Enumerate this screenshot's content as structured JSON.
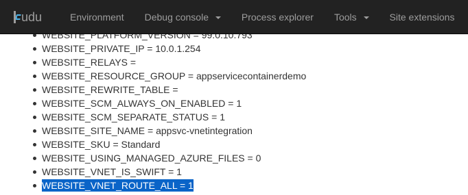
{
  "navbar": {
    "brand": "udu",
    "items": [
      {
        "label": "Environment",
        "dropdown": false
      },
      {
        "label": "Debug console",
        "dropdown": true
      },
      {
        "label": "Process explorer",
        "dropdown": false
      },
      {
        "label": "Tools",
        "dropdown": true
      },
      {
        "label": "Site extensions",
        "dropdown": false
      }
    ]
  },
  "env_vars": [
    {
      "text": "WEBSITE_PLATFORM_VERSION = 99.0.10.793",
      "selected": false
    },
    {
      "text": "WEBSITE_PRIVATE_IP = 10.0.1.254",
      "selected": false
    },
    {
      "text": "WEBSITE_RELAYS =",
      "selected": false
    },
    {
      "text": "WEBSITE_RESOURCE_GROUP = appservicecontainerdemo",
      "selected": false
    },
    {
      "text": "WEBSITE_REWRITE_TABLE =",
      "selected": false
    },
    {
      "text": "WEBSITE_SCM_ALWAYS_ON_ENABLED = 1",
      "selected": false
    },
    {
      "text": "WEBSITE_SCM_SEPARATE_STATUS = 1",
      "selected": false
    },
    {
      "text": "WEBSITE_SITE_NAME = appsvc-vnetintegration",
      "selected": false
    },
    {
      "text": "WEBSITE_SKU = Standard",
      "selected": false
    },
    {
      "text": "WEBSITE_USING_MANAGED_AZURE_FILES = 0",
      "selected": false
    },
    {
      "text": "WEBSITE_VNET_IS_SWIFT = 1",
      "selected": false
    },
    {
      "text": "WEBSITE_VNET_ROUTE_ALL = 1",
      "selected": true
    }
  ],
  "colors": {
    "navbar_bg": "#222222",
    "nav_text": "#9d9d9d",
    "brand_accent": "#4db3e8",
    "selection_bg": "#0a64c8",
    "selection_text": "#ffffff",
    "body_text": "#333333"
  }
}
